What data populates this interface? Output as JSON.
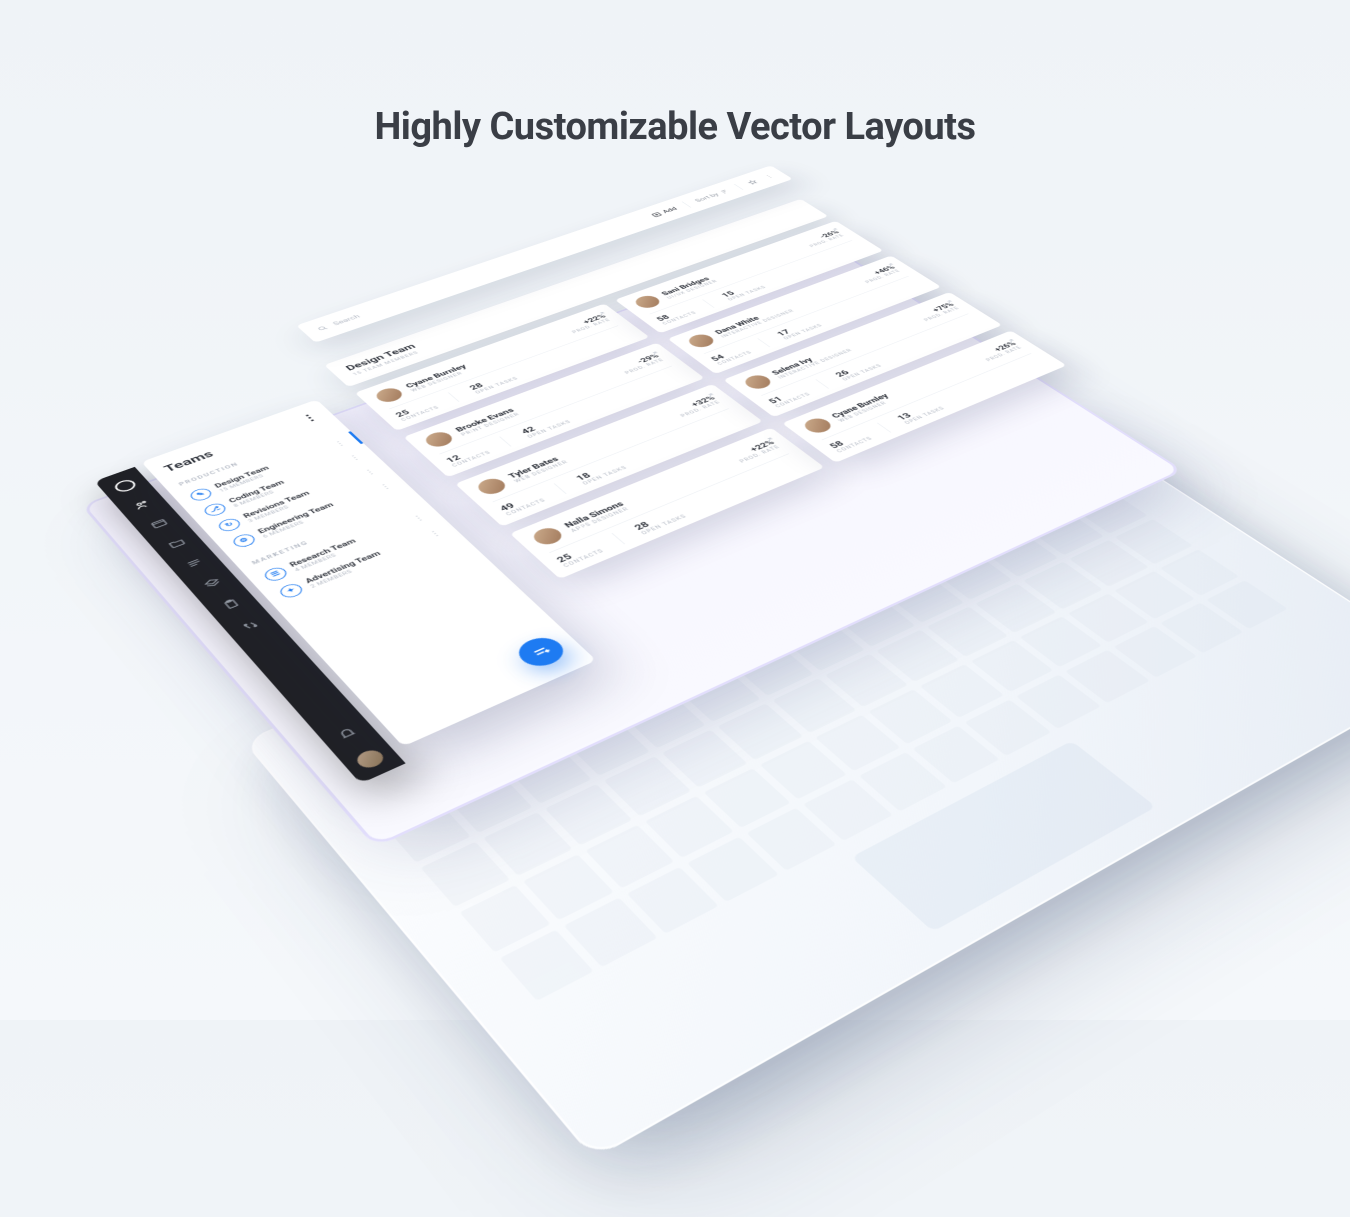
{
  "hero": {
    "title": "Highly Customizable Vector Layouts"
  },
  "toolbar": {
    "search_placeholder": "Search",
    "add": "Add",
    "sort": "Sort by"
  },
  "sidebar": {
    "title": "Teams",
    "sections": [
      {
        "label": "PRODUCTION",
        "items": [
          {
            "name": "Design Team",
            "sub": "15 MEMBERS"
          },
          {
            "name": "Coding Team",
            "sub": "8 MEMBERS"
          },
          {
            "name": "Revisions Team",
            "sub": "3 MEMBERS"
          },
          {
            "name": "Engineering Team",
            "sub": "6 MEMBERS"
          }
        ]
      },
      {
        "label": "MARKETING",
        "items": [
          {
            "name": "Research Team",
            "sub": "4 MEMBERS"
          },
          {
            "name": "Advertising Team",
            "sub": "2 MEMBERS"
          }
        ]
      }
    ]
  },
  "content": {
    "header": {
      "title": "Design Team",
      "sub": "15 TEAM MEMBERS"
    },
    "rate_label": "PROD. RATE",
    "contacts_label": "CONTACTS",
    "tasks_label": "OPEN TASKS",
    "members": [
      {
        "name": "Cyane Burnley",
        "role": "WEB DESIGNER",
        "rate": "+22%",
        "contacts": "25",
        "tasks": "28"
      },
      {
        "name": "Sani Bridges",
        "role": "UI/UX DESIGNER",
        "rate": "-26%",
        "contacts": "58",
        "tasks": "15"
      },
      {
        "name": "Brooke Evans",
        "role": "PRINT DESIGNER",
        "rate": "-29%",
        "contacts": "12",
        "tasks": "42"
      },
      {
        "name": "Dana White",
        "role": "INTERACTIVE DESIGNER",
        "rate": "+46%",
        "contacts": "54",
        "tasks": "17"
      },
      {
        "name": "Tyler Bates",
        "role": "WEB DESIGNER",
        "rate": "+32%",
        "contacts": "49",
        "tasks": "18"
      },
      {
        "name": "Selena Ivy",
        "role": "INTERACTIVE DESIGNER",
        "rate": "+75%",
        "contacts": "51",
        "tasks": "26"
      },
      {
        "name": "Nalla Simons",
        "role": "APPS DESIGNER",
        "rate": "+22%",
        "contacts": "25",
        "tasks": "28"
      },
      {
        "name": "Cyane Burnley",
        "role": "WEB DESIGNER",
        "rate": "+26%",
        "contacts": "58",
        "tasks": "13"
      }
    ]
  }
}
